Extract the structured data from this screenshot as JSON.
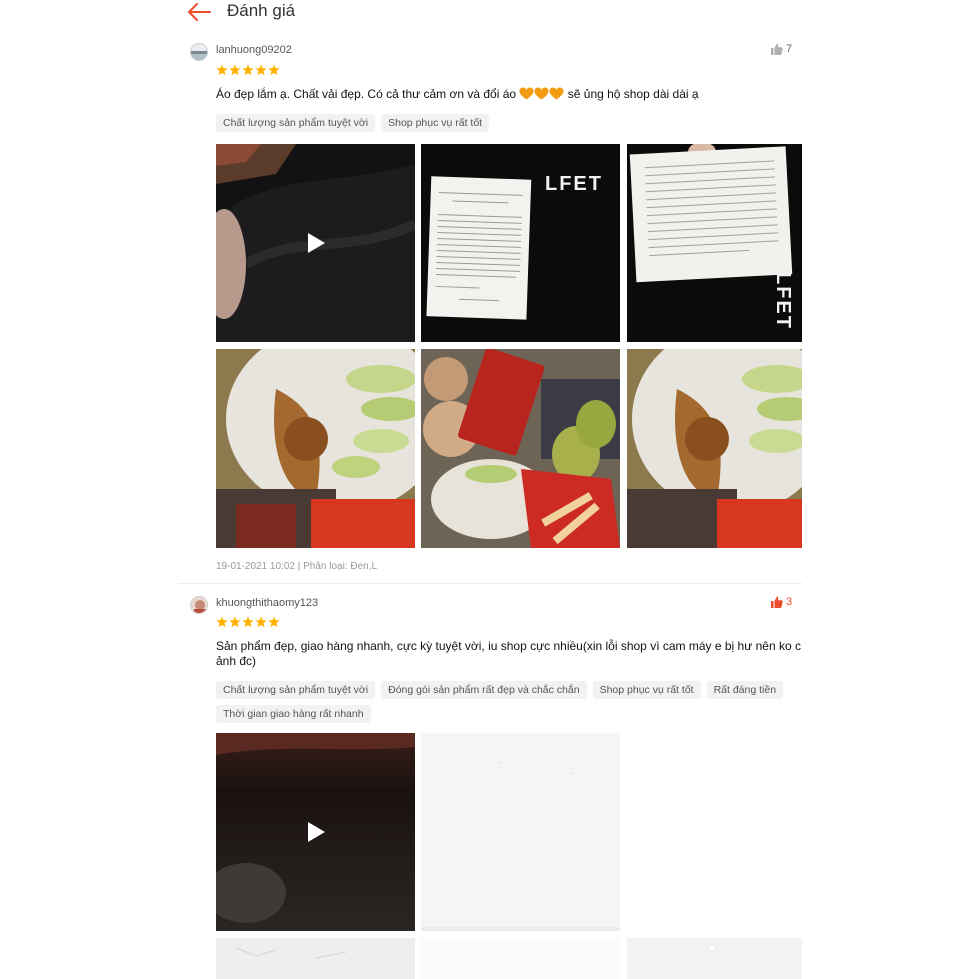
{
  "header": {
    "title": "Đánh giá"
  },
  "reviews": [
    {
      "username": "lanhuong09202",
      "likes": "7",
      "rating": 5,
      "comment_before": "Áo đẹp lắm ạ. Chất vải đẹp. Có cả thư cảm ơn và đổi áo",
      "comment_after": "sẽ ủng hộ shop dài dài ạ",
      "tags": [
        "Chất lượng sản phẩm tuyệt vời",
        "Shop phục vụ rất tốt"
      ],
      "meta": "19-01-2021 10:02 | Phân loại: Đen,L",
      "shirt_text": "LFET"
    },
    {
      "username": "khuongthithaomy123",
      "likes": "3",
      "rating": 5,
      "comment": "Sản phẩm đẹp, giao hàng nhanh, cực kỳ tuyệt vời, iu shop cực nhiều(xin lỗi shop vì cam máy e bị hư nên ko c ảnh đc)",
      "tags": [
        "Chất lượng sản phẩm tuyệt vời",
        "Đóng gói sản phẩm rất đẹp và chắc chắn",
        "Shop phục vụ rất tốt",
        "Rất đáng tiền",
        "Thời gian giao hàng rất nhanh"
      ]
    }
  ],
  "colors": {
    "accent": "#ee4d2d",
    "star": "#ffb200",
    "heart": "#f39c12"
  }
}
